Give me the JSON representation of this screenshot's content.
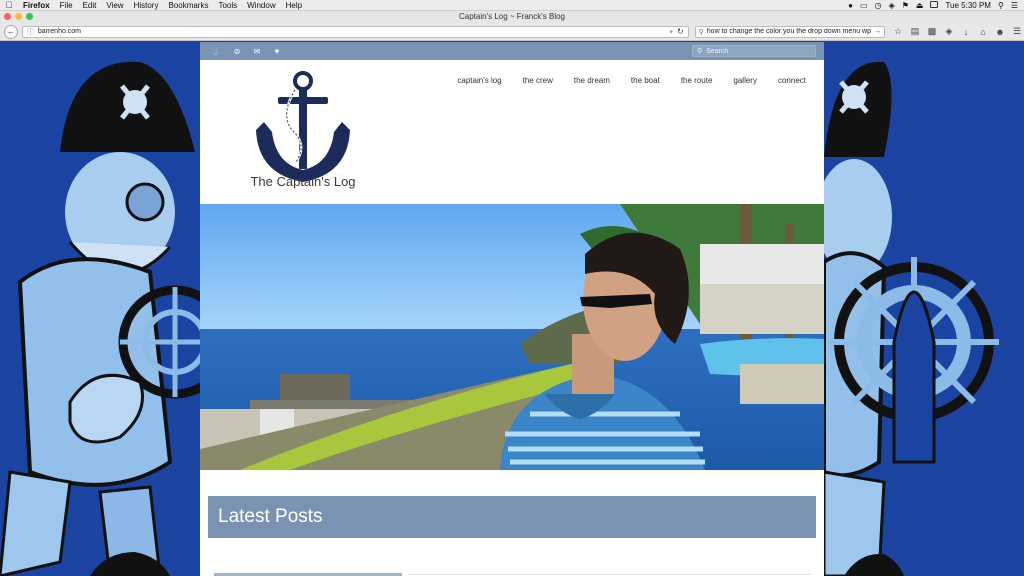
{
  "menubar": {
    "app": "Firefox",
    "items": [
      "File",
      "Edit",
      "View",
      "History",
      "Bookmarks",
      "Tools",
      "Window",
      "Help"
    ],
    "clock": "Tue 5:30 PM"
  },
  "window": {
    "title": "Captain's Log ~ Franck's Blog"
  },
  "toolbar": {
    "url": "barrenho.com",
    "search_query": "how to change the color you the drop down menu wp"
  },
  "site": {
    "search_placeholder": "Search",
    "topbar_icons": [
      "anchor-icon",
      "no-entry-icon",
      "mail-icon",
      "heart-icon"
    ],
    "logo_text": "The Captain's Log",
    "nav": [
      "captain's log",
      "the crew",
      "the dream",
      "the boat",
      "the route",
      "gallery",
      "connect"
    ],
    "latest_title": "Latest Posts"
  },
  "colors": {
    "accent": "#7b93b3",
    "background": "#1f47a8",
    "anchor": "#1d2b5a"
  }
}
